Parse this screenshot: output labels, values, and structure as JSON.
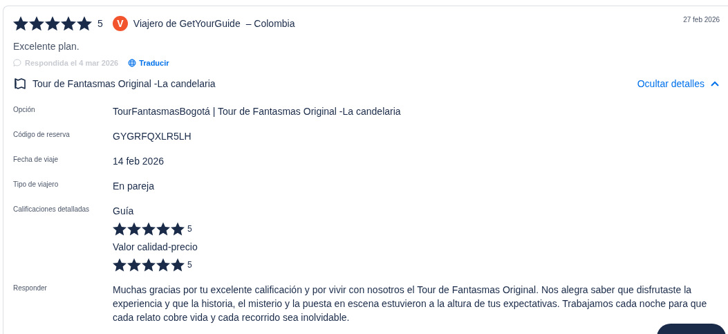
{
  "review": {
    "stars": 5,
    "rating": "5",
    "avatar_letter": "V",
    "author": "Viajero de GetYourGuide",
    "country": "– Colombia",
    "date": "27 feb 2026",
    "text": "Excelente plan.",
    "responded": "Respondida el 4 mar 2026",
    "translate": "Traducir"
  },
  "activity": {
    "title": "Tour de Fantasmas Original -La candelaria",
    "toggle": "Ocultar detalles",
    "expanded": true
  },
  "details": [
    {
      "kind": "text",
      "label": "Opción",
      "value": "TourFantasmasBogotá | Tour de Fantasmas Original -La candelaria"
    },
    {
      "kind": "text",
      "label": "Código de reserva",
      "value": "GYGRFQXLR5LH"
    },
    {
      "kind": "text",
      "label": "Fecha de viaje",
      "value": "14 feb 2026"
    },
    {
      "kind": "text",
      "label": "Tipo de viajero",
      "value": "En pareja"
    },
    {
      "kind": "ratings",
      "label": "Calificaciones detalladas",
      "ratings": [
        {
          "name": "Guía",
          "stars": 5,
          "rating": "5"
        },
        {
          "name": "Valor calidad-precio",
          "stars": 5,
          "rating": "5"
        }
      ]
    },
    {
      "kind": "text",
      "label": "Responder",
      "value": "Muchas gracias por tu excelente calificación y por vivir con nosotros el Tour de Fantasmas Original. Nos alegra saber que disfrutaste la experiencia y que la historia, el misterio y la puesta en escena estuvieron a la altura de tus expectativas. Trabajamos cada noche para que cada relato cobre vida y cada recorrido sea inolvidable."
    }
  ]
}
